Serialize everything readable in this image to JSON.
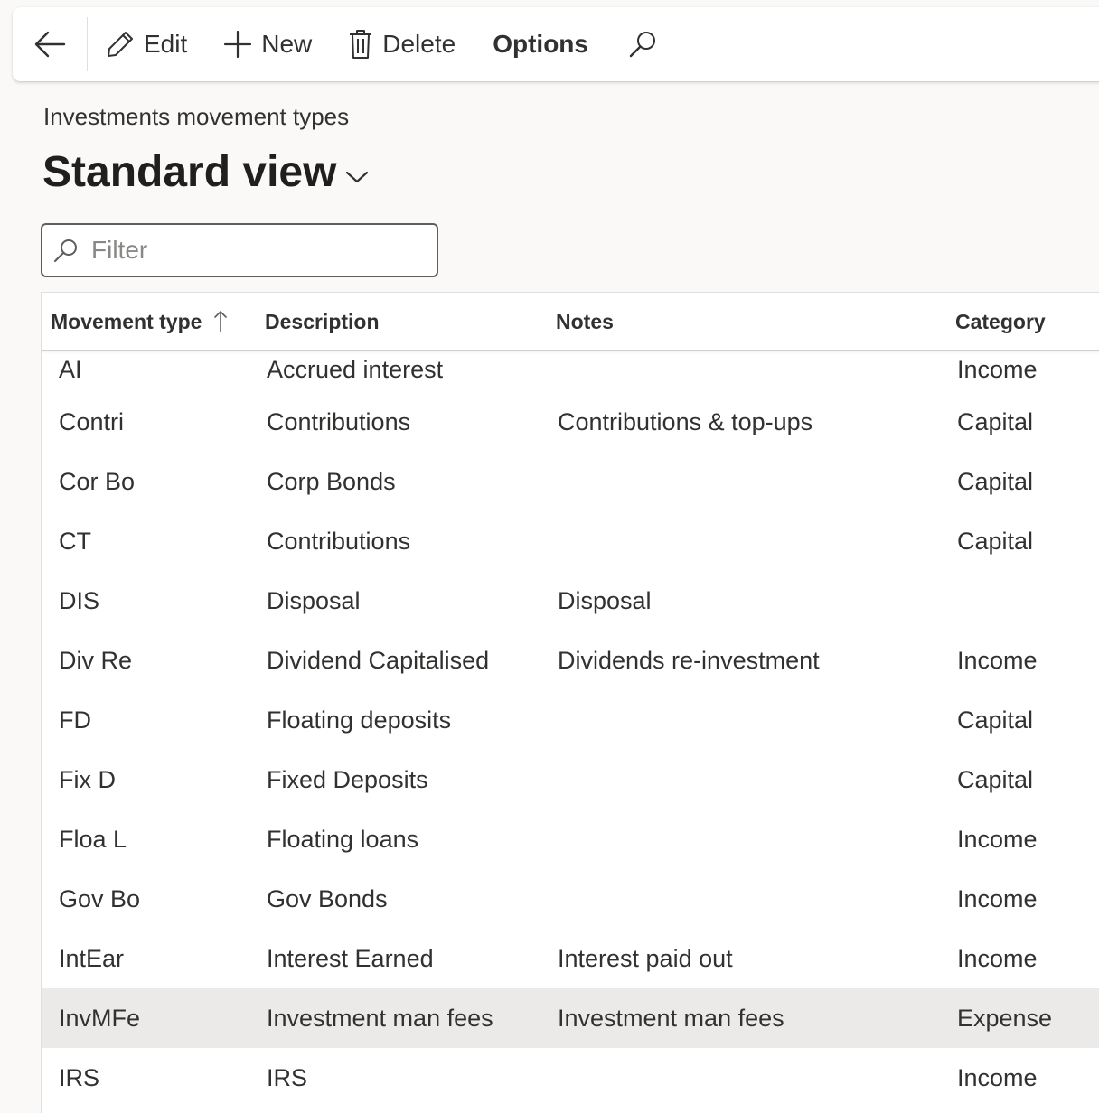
{
  "toolbar": {
    "edit_label": "Edit",
    "new_label": "New",
    "delete_label": "Delete",
    "options_label": "Options"
  },
  "page": {
    "caption": "Investments movement types",
    "view_title": "Standard view"
  },
  "filter": {
    "placeholder": "Filter",
    "value": ""
  },
  "grid": {
    "columns": {
      "movement_type": "Movement type",
      "description": "Description",
      "notes": "Notes",
      "category": "Category"
    },
    "sort": {
      "column": "movement_type",
      "direction": "ascending"
    },
    "rows": [
      {
        "type": "AI",
        "description": "Accrued interest",
        "notes": "",
        "category": "Income"
      },
      {
        "type": "Contri",
        "description": "Contributions",
        "notes": "Contributions & top-ups",
        "category": "Capital"
      },
      {
        "type": "Cor Bo",
        "description": "Corp Bonds",
        "notes": "",
        "category": "Capital"
      },
      {
        "type": "CT",
        "description": "Contributions",
        "notes": "",
        "category": "Capital"
      },
      {
        "type": "DIS",
        "description": "Disposal",
        "notes": "Disposal",
        "category": ""
      },
      {
        "type": "Div Re",
        "description": "Dividend Capitalised",
        "notes": "Dividends re-investment",
        "category": "Income"
      },
      {
        "type": "FD",
        "description": "Floating deposits",
        "notes": "",
        "category": "Capital"
      },
      {
        "type": "Fix D",
        "description": "Fixed Deposits",
        "notes": "",
        "category": "Capital"
      },
      {
        "type": "Floa L",
        "description": "Floating loans",
        "notes": "",
        "category": "Income"
      },
      {
        "type": "Gov Bo",
        "description": "Gov Bonds",
        "notes": "",
        "category": "Income"
      },
      {
        "type": "IntEar",
        "description": "Interest Earned",
        "notes": "Interest paid out",
        "category": "Income"
      },
      {
        "type": "InvMFe",
        "description": "Investment man fees",
        "notes": "Investment man fees",
        "category": "Expense",
        "selected": true
      },
      {
        "type": "IRS",
        "description": "IRS",
        "notes": "",
        "category": "Income"
      }
    ]
  },
  "icons": {
    "back": "back-arrow-icon",
    "edit": "pencil-icon",
    "new": "plus-icon",
    "delete": "trash-icon",
    "search": "search-icon",
    "view_dropdown": "chevron-down-icon",
    "sort": "sort-ascending-icon"
  },
  "colors": {
    "selected_row": "#ebeae8",
    "background": "#faf9f8"
  }
}
